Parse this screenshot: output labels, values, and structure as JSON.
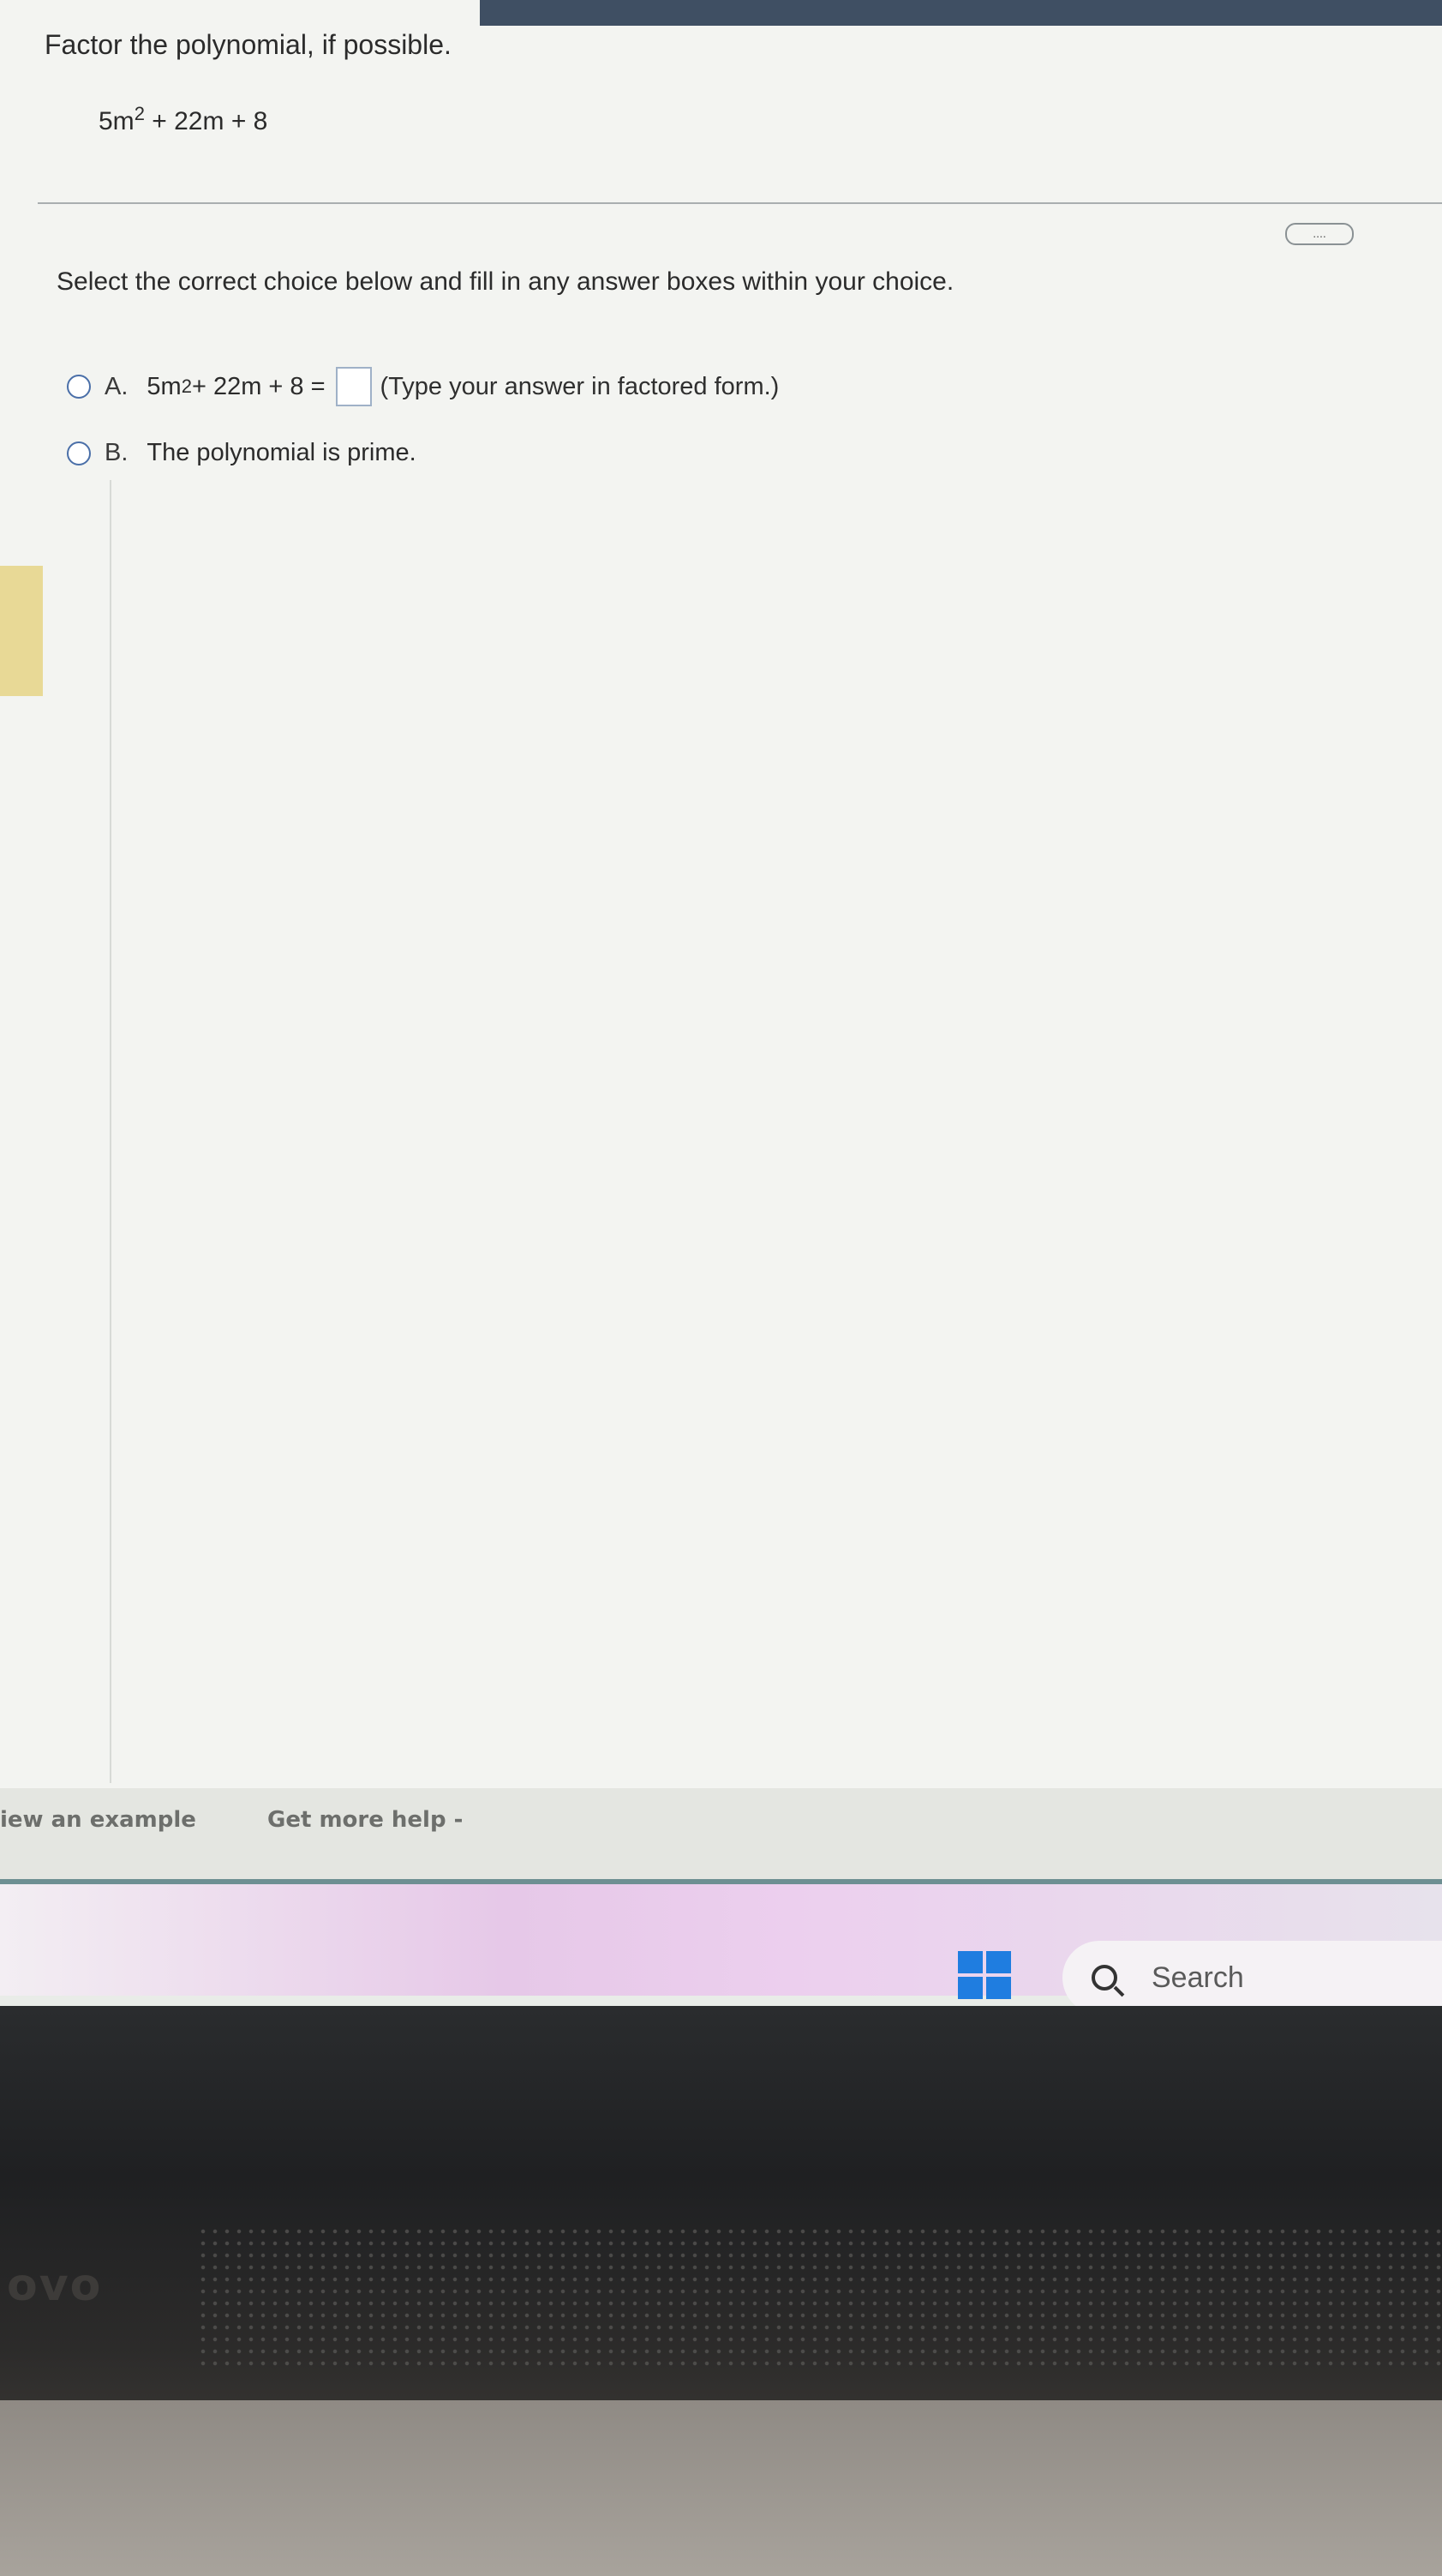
{
  "question": {
    "prompt": "Factor the polynomial, if possible.",
    "expression": {
      "coef": "5m",
      "exponent": "2",
      "rest": " + 22m + 8"
    }
  },
  "more_button": "....",
  "instruction": "Select the correct choice below and fill in any answer boxes within your choice.",
  "choices": [
    {
      "letter": "A.",
      "coef": "5m",
      "exponent": "2",
      "rest": " + 22m + 8 =",
      "answer_value": "",
      "hint": "(Type your answer in factored form.)"
    },
    {
      "letter": "B.",
      "text": "The polynomial is prime."
    }
  ],
  "bottom_links": {
    "example": "iew an example",
    "help": "Get more help -"
  },
  "taskbar": {
    "search_label": "Search"
  },
  "bezel": {
    "logo": "ovo"
  },
  "colors": {
    "radio_border": "#4a6fa8",
    "start_blue": "#1f7de0",
    "taskbar_pink": "#e6c8e8"
  }
}
